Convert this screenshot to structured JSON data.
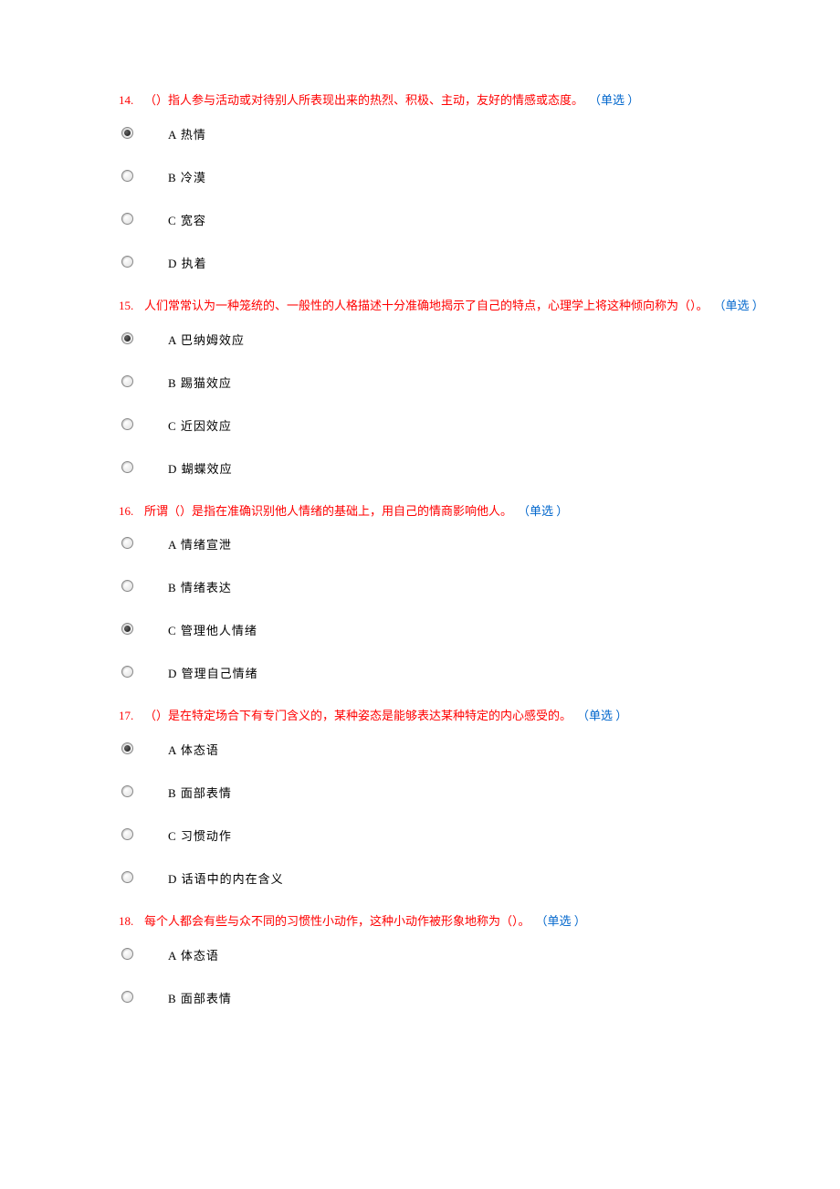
{
  "type_label": "（单选 ）",
  "questions": [
    {
      "number": "14.",
      "text": "（）指人参与活动或对待别人所表现出来的热烈、积极、主动，友好的情感或态度。",
      "selected": 0,
      "options": [
        "A 热情",
        "B 冷漠",
        "C 宽容",
        "D 执着"
      ]
    },
    {
      "number": "15.",
      "text": "人们常常认为一种笼统的、一般性的人格描述十分准确地揭示了自己的特点，心理学上将这种倾向称为（）。",
      "selected": 0,
      "options": [
        "A 巴纳姆效应",
        "B 踢猫效应",
        "C 近因效应",
        "D 蝴蝶效应"
      ]
    },
    {
      "number": "16.",
      "text": "所谓（）是指在准确识别他人情绪的基础上，用自己的情商影响他人。",
      "selected": 2,
      "options": [
        "A 情绪宣泄",
        "B 情绪表达",
        "C 管理他人情绪",
        "D 管理自己情绪"
      ]
    },
    {
      "number": "17.",
      "text": "（）是在特定场合下有专门含义的，某种姿态是能够表达某种特定的内心感受的。",
      "selected": 0,
      "options": [
        "A 体态语",
        "B 面部表情",
        "C 习惯动作",
        "D 话语中的内在含义"
      ]
    },
    {
      "number": "18.",
      "text": "每个人都会有些与众不同的习惯性小动作，这种小动作被形象地称为（）。",
      "selected": -1,
      "options": [
        "A 体态语",
        "B 面部表情"
      ]
    }
  ]
}
